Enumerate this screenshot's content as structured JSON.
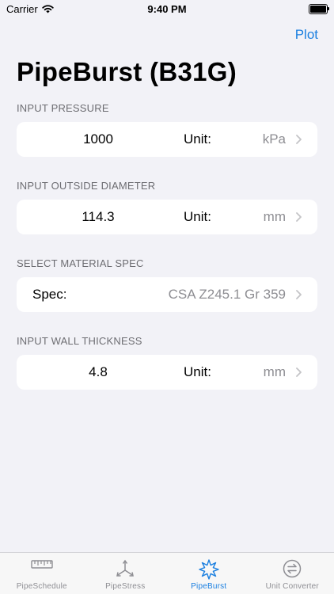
{
  "status_bar": {
    "carrier": "Carrier",
    "time": "9:40 PM"
  },
  "nav": {
    "plot_label": "Plot"
  },
  "page": {
    "title": "PipeBurst (B31G)"
  },
  "sections": {
    "pressure": {
      "header": "INPUT PRESSURE",
      "value": "1000",
      "unit_label": "Unit:",
      "unit_value": "kPa"
    },
    "diameter": {
      "header": "INPUT OUTSIDE DIAMETER",
      "value": "114.3",
      "unit_label": "Unit:",
      "unit_value": "mm"
    },
    "material": {
      "header": "SELECT MATERIAL SPEC",
      "spec_label": "Spec:",
      "spec_value": "CSA Z245.1 Gr 359"
    },
    "thickness": {
      "header": "INPUT WALL THICKNESS",
      "value": "4.8",
      "unit_label": "Unit:",
      "unit_value": "mm"
    }
  },
  "tabs": [
    {
      "label": "PipeSchedule",
      "icon": "ruler-icon"
    },
    {
      "label": "PipeStress",
      "icon": "axes-icon"
    },
    {
      "label": "PipeBurst",
      "icon": "burst-icon",
      "active": true
    },
    {
      "label": "Unit Converter",
      "icon": "convert-icon"
    }
  ],
  "colors": {
    "accent": "#1a7fe0",
    "background": "#f2f2f7",
    "secondary_text": "#8e8e93"
  }
}
